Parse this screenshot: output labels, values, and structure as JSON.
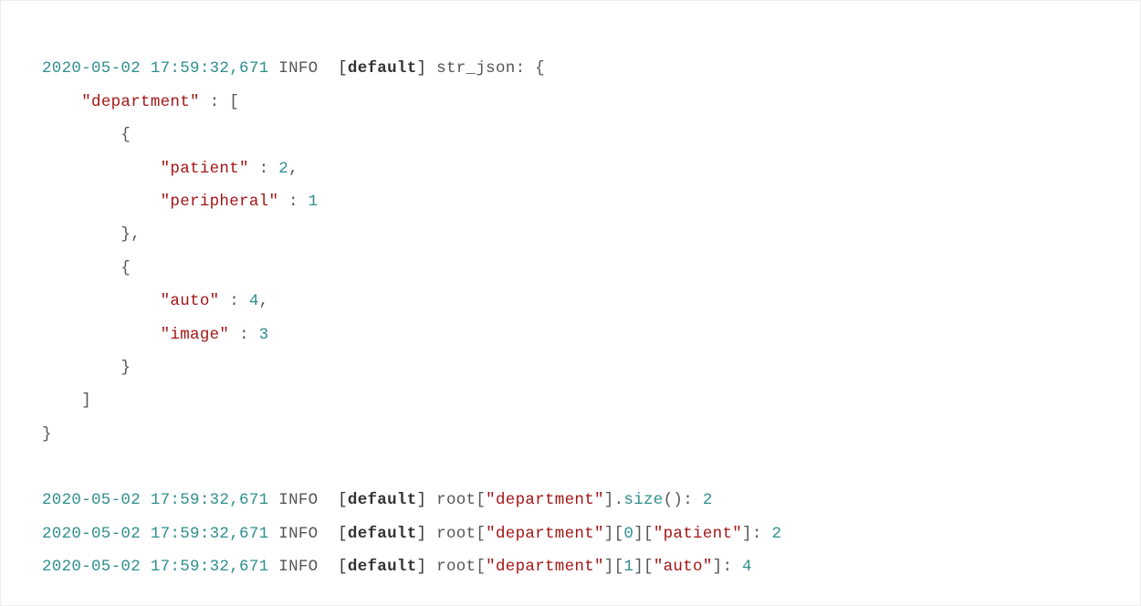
{
  "log": {
    "ts": "2020-05-02 17:59:32,671",
    "level": "INFO",
    "logger_open": "[",
    "logger": "default",
    "logger_close": "]",
    "msg1": "str_json: {",
    "close_brace": "}",
    "json": {
      "key_department": "\"department\"",
      "colon": " : ",
      "open_bracket": "[",
      "open_brace": "{",
      "key_patient": "\"patient\"",
      "val_patient": "2",
      "comma": ",",
      "key_peripheral": "\"peripheral\"",
      "val_peripheral": "1",
      "close_brace": "}",
      "key_auto": "\"auto\"",
      "val_auto": "4",
      "key_image": "\"image\"",
      "val_image": "3",
      "close_bracket": "]"
    },
    "line2": {
      "prefix": "root[",
      "dept": "\"department\"",
      "mid": "].",
      "func": "size",
      "call": "(): ",
      "val": "2"
    },
    "line3": {
      "prefix": "root[",
      "dept": "\"department\"",
      "mid1": "][",
      "idx": "0",
      "mid2": "][",
      "key": "\"patient\"",
      "mid3": "]: ",
      "val": "2"
    },
    "line4": {
      "prefix": "root[",
      "dept": "\"department\"",
      "mid1": "][",
      "idx": "1",
      "mid2": "][",
      "key": "\"auto\"",
      "mid3": "]: ",
      "val": "4"
    }
  }
}
